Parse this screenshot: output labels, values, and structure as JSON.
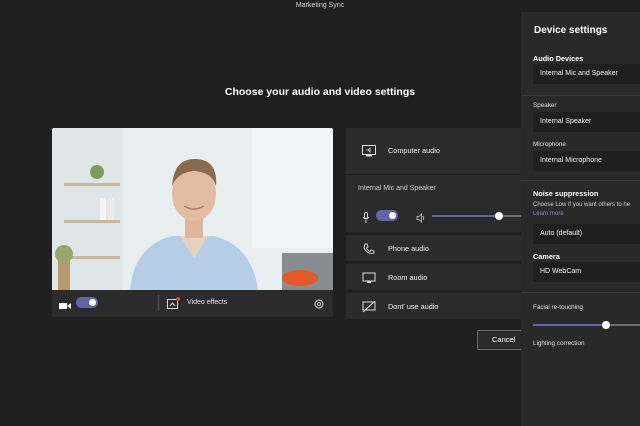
{
  "window": {
    "title": "Marketing Sync"
  },
  "heading": "Choose your audio and video settings",
  "preview": {
    "camera_on": true,
    "video_effects_label": "Video effects"
  },
  "audio_options": {
    "computer_audio": "Computer audio",
    "selected_device": "Internal Mic and Speaker",
    "mic_on": true,
    "speaker_volume": 0.8,
    "phone_audio": "Phone audio",
    "room_audio": "Room audio",
    "dont_use_audio": "Dont' use audio"
  },
  "cancel_label": "Cancel",
  "device_settings": {
    "title": "Device settings",
    "audio_devices_label": "Audio Devices",
    "audio_devices_value": "Internal Mic and Speaker",
    "speaker_label": "Speaker",
    "speaker_value": "Internal Speaker",
    "microphone_label": "Microphone",
    "microphone_value": "Internal Microphone",
    "noise_suppression_label": "Noise suppression",
    "noise_hint": "Choose Low if you want others to he",
    "learn_more": "Learn more",
    "noise_value": "Auto (default)",
    "camera_label": "Camera",
    "camera_value": "HD WebCam",
    "facial_retouching_label": "Facial re-touching",
    "facial_retouching_level": 0.68,
    "lighting_correction_label": "Lighting correction"
  },
  "colors": {
    "accent": "#6264a7",
    "background": "#1f1f1f",
    "panel": "#292929"
  }
}
